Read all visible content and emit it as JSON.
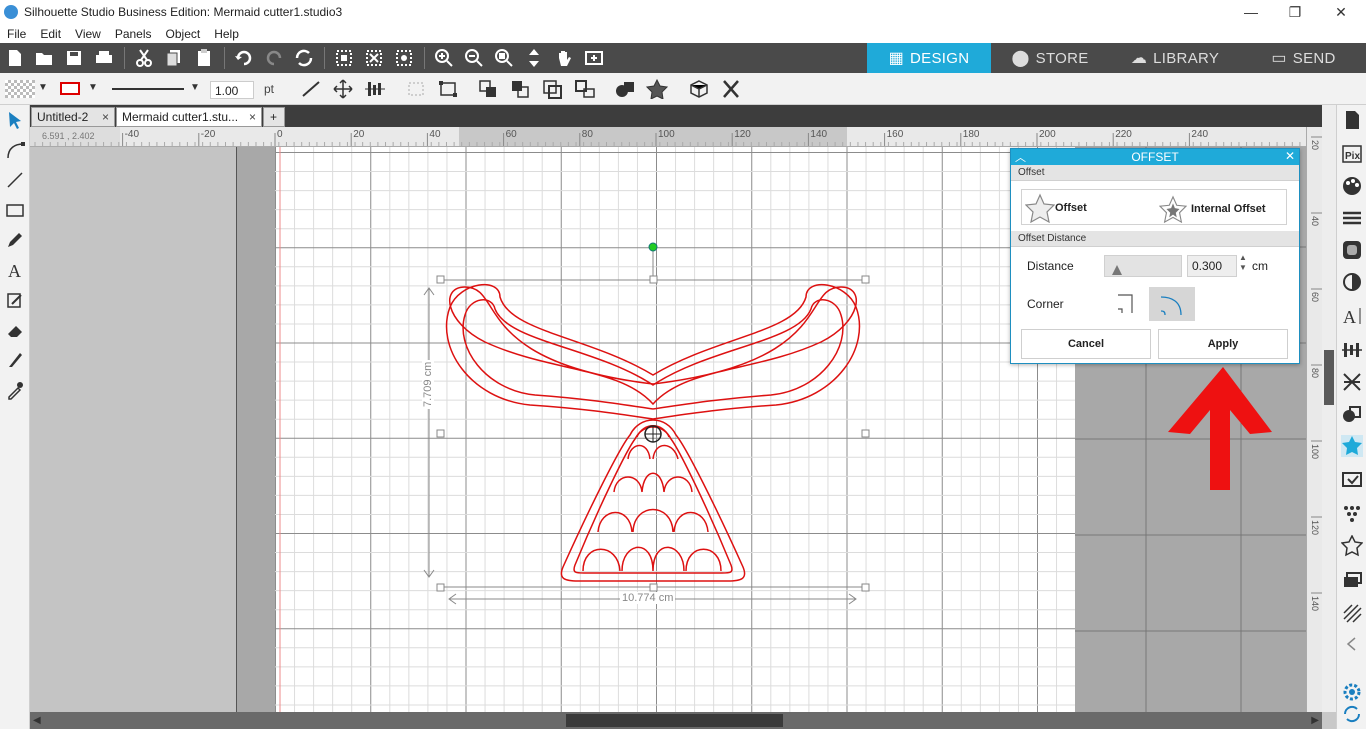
{
  "window": {
    "title": "Silhouette Studio Business Edition: Mermaid cutter1.studio3",
    "minimize": "—",
    "restore": "❐",
    "close": "✕"
  },
  "menu": [
    "File",
    "Edit",
    "View",
    "Panels",
    "Object",
    "Help"
  ],
  "nav_tabs": [
    {
      "label": "DESIGN",
      "icon": "design-grid-icon",
      "active": true
    },
    {
      "label": "STORE",
      "icon": "store-s-icon",
      "active": false
    },
    {
      "label": "LIBRARY",
      "icon": "library-cloud-icon",
      "active": false
    },
    {
      "label": "SEND",
      "icon": "send-machine-icon",
      "active": false
    }
  ],
  "line_settings": {
    "width_value": "1.00",
    "unit": "pt"
  },
  "doc_tabs": [
    {
      "label": "Untitled-2",
      "close": "×"
    },
    {
      "label": "Mermaid cutter1.stu...",
      "close": "×"
    },
    {
      "label": "+"
    }
  ],
  "cursor_readout": "6.591 , 2.402",
  "ruler": {
    "h_ticks": [
      "-40",
      "-20",
      "0",
      "20",
      "40",
      "60",
      "80",
      "100",
      "120",
      "140",
      "160",
      "180",
      "200",
      "220",
      "240"
    ],
    "v_ticks": [
      "20",
      "40",
      "60",
      "80",
      "100",
      "120",
      "140"
    ]
  },
  "selection": {
    "height_label": "7.709 cm",
    "width_label": "10.774 cm"
  },
  "offset_panel": {
    "title": "OFFSET",
    "section_offset": "Offset",
    "offset_option": "Offset",
    "internal_offset_option": "Internal Offset",
    "section_distance": "Offset Distance",
    "distance_label": "Distance",
    "distance_value": "0.300",
    "distance_unit": "cm",
    "corner_label": "Corner",
    "corner_selected": "rounded",
    "cancel_label": "Cancel",
    "apply_label": "Apply"
  },
  "colors": {
    "accent": "#1faad9",
    "toolbar_dark": "#4a4a4a",
    "cut_line": "#dd1111",
    "annotation_arrow": "#ee1111",
    "rotation_handle": "#22cc22"
  }
}
